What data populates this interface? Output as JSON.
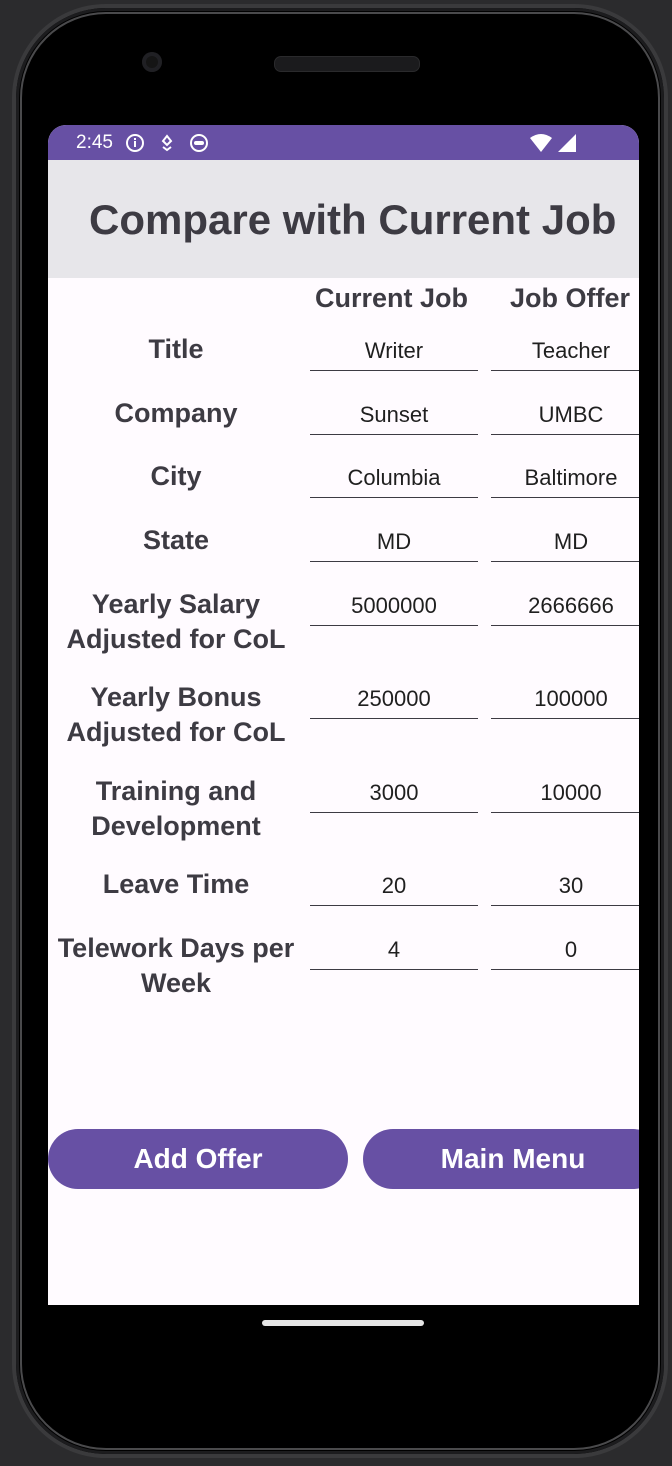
{
  "status_bar": {
    "time": "2:45"
  },
  "app_bar": {
    "title": "Compare with Current Job"
  },
  "columns": {
    "current": "Current Job",
    "offer": "Job Offer"
  },
  "rows": [
    {
      "label": "Title",
      "current": "Writer",
      "offer": "Teacher"
    },
    {
      "label": "Company",
      "current": "Sunset",
      "offer": "UMBC"
    },
    {
      "label": "City",
      "current": "Columbia",
      "offer": "Baltimore"
    },
    {
      "label": "State",
      "current": "MD",
      "offer": "MD"
    },
    {
      "label": "Yearly Salary Adjusted for CoL",
      "current": "5000000",
      "offer": "2666666"
    },
    {
      "label": "Yearly Bonus Adjusted for CoL",
      "current": "250000",
      "offer": "100000"
    },
    {
      "label": "Training and Development",
      "current": "3000",
      "offer": "10000"
    },
    {
      "label": "Leave Time",
      "current": "20",
      "offer": "30"
    },
    {
      "label": "Telework Days per Week",
      "current": "4",
      "offer": "0"
    }
  ],
  "buttons": {
    "add_offer": "Add Offer",
    "main_menu": "Main Menu"
  },
  "colors": {
    "primary": "#6750a4",
    "app_bar_bg": "#e7e6ea",
    "text_dark": "#3d3b43"
  }
}
